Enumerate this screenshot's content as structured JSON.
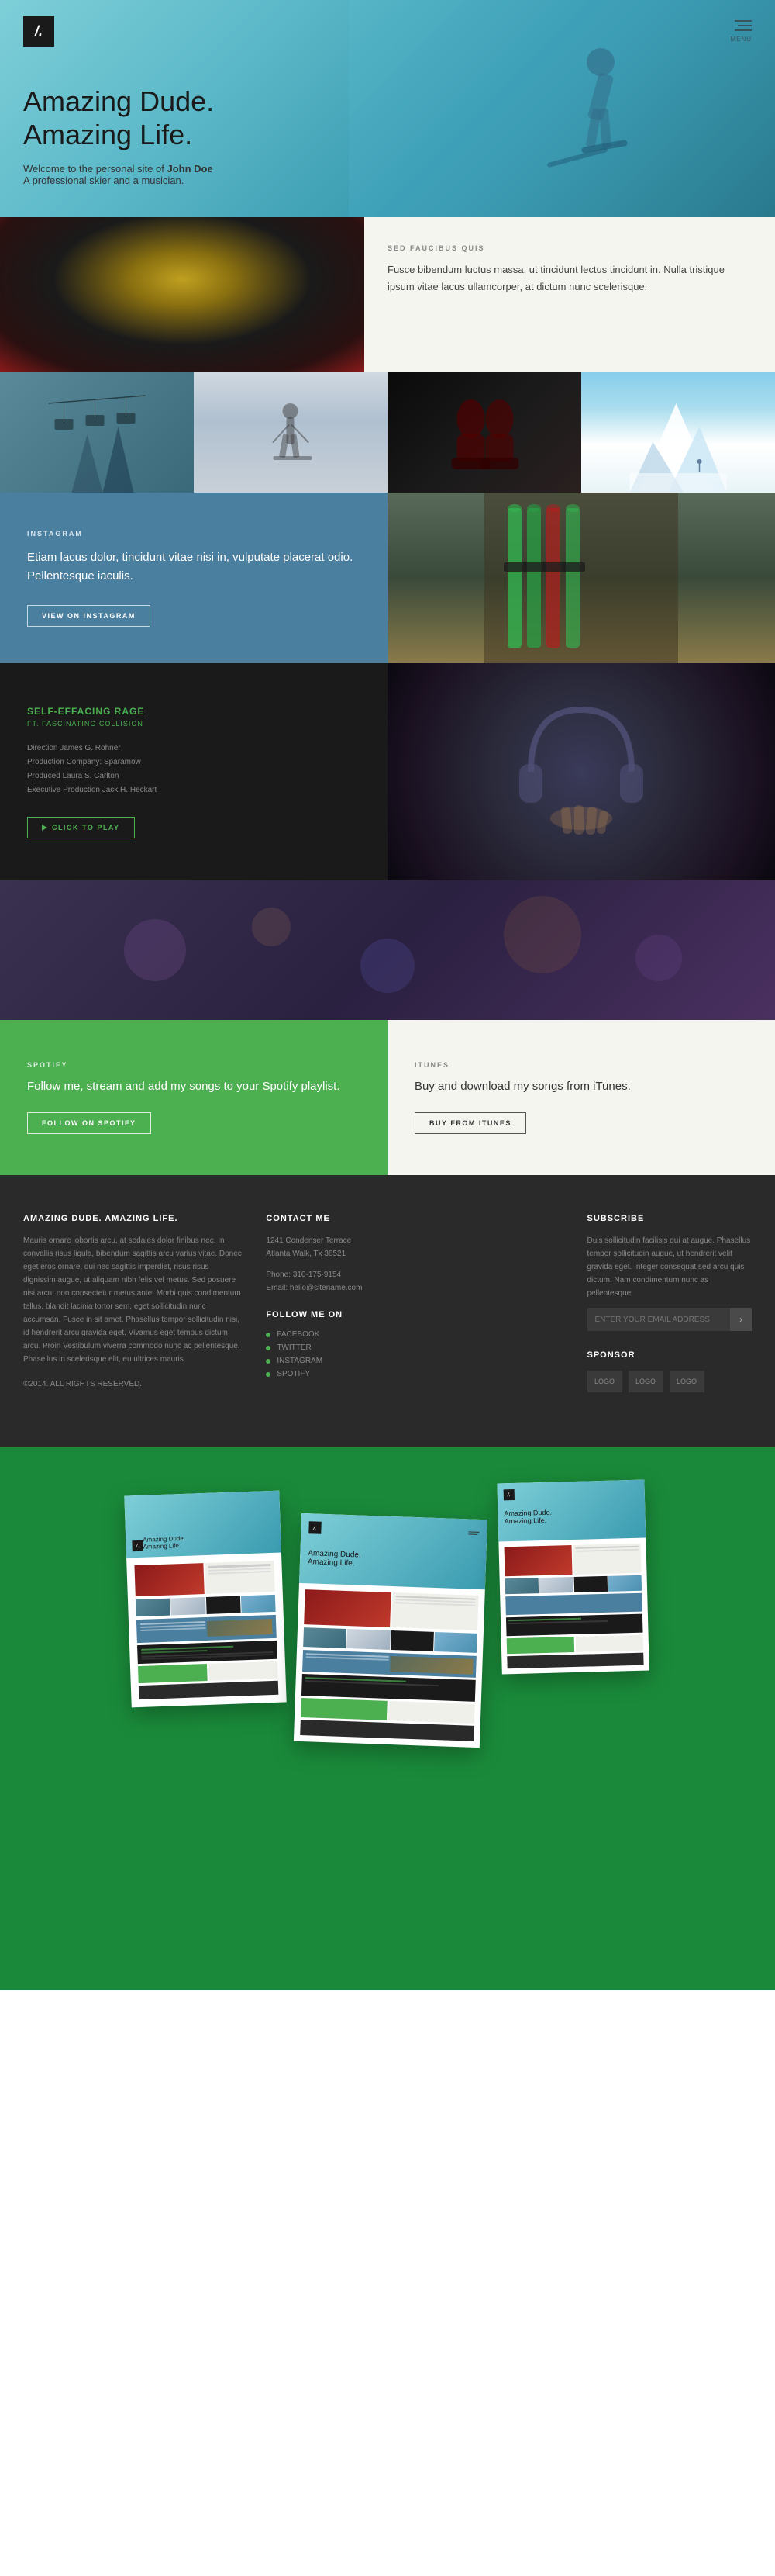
{
  "header": {
    "logo": "/.",
    "menu_label": "MENU",
    "title_line1": "Amazing Dude.",
    "title_line2": "Amazing Life.",
    "subtitle": "Welcome to the personal site of",
    "name": "John Doe",
    "description": "A professional skier and a musician."
  },
  "section_faucibus": {
    "label": "SED FAUCIBUS QUIS",
    "text": "Fusce bibendum luctus massa, ut tincidunt lectus tincidunt in. Nulla tristique ipsum vitae lacus ullamcorper, at dictum nunc scelerisque."
  },
  "instagram": {
    "label": "INSTAGRAM",
    "text": "Etiam lacus dolor, tincidunt vitae nisi in, vulputate placerat odio. Pellentesque iaculis.",
    "button": "VIEW ON INSTAGRAM"
  },
  "music_video": {
    "title": "SELF-EFFACING RAGE",
    "subtitle": "FT. FASCINATING COLLISION",
    "credit1": "Direction James G. Rohner",
    "credit2": "Production Company: Sparamow",
    "credit3": "Produced Laura S. Carlton",
    "credit4": "Executive Production Jack H. Heckart",
    "button": "CLICK TO PLAY"
  },
  "spotify": {
    "label": "SPOTIFY",
    "text": "Follow me, stream and add my songs to your Spotify playlist.",
    "button": "FOLLOW ON SPOTIFY"
  },
  "itunes": {
    "label": "ITUNES",
    "text": "Buy and download my songs from iTunes.",
    "button": "BUY FROM ITUNES"
  },
  "footer": {
    "brand_title": "AMAZING DUDE. AMAZING LIFE.",
    "brand_text": "Mauris ornare lobortis arcu, at sodales dolor finibus nec. In convallis risus ligula, bibendum sagittis arcu varius vitae. Donec eget eros ornare, dui nec sagittis imperdiet, risus risus dignissim augue, ut aliquam nibh felis vel metus. Sed posuere nisi arcu, non consectetur metus ante. Morbi quis condimentum tellus, blandit lacinia tortor sem, eget sollicitudin nunc accumsan. Fusce in sit amet. Phasellus tempor sollicitudin nisi, id hendrerit arcu gravida eget. Vivamus eget tempus dictum arcu. Proin Vestibulum viverra commodo nunc ac pellentesque. Phasellus in scelerisque elit, eu ultrices mauris.",
    "copyright": "©2014. ALL RIGHTS RESERVED.",
    "contact_title": "CONTACT ME",
    "address_line1": "1241 Condenser Terrace",
    "address_line2": "Atlanta Walk, Tx 38521",
    "phone_label": "Phone:",
    "phone": "310-175-9154",
    "email_label": "Email:",
    "email": "hello@sitename.com",
    "follow_title": "FOLLOW ME ON",
    "social_links": [
      {
        "label": "FACEBOOK"
      },
      {
        "label": "TWITTER"
      },
      {
        "label": "INSTAGRAM"
      },
      {
        "label": "SPOTIFY"
      }
    ],
    "subscribe_title": "SUBSCRIBE",
    "subscribe_text": "Duis sollicitudin facilisis dui at augue. Phasellus tempor sollicitudin augue, ut hendrerit velit gravida eget. Integer consequat sed arcu quis dictum. Nam condimentum nunc as pellentesque.",
    "input_placeholder": "ENTER YOUR EMAIL ADDRESS",
    "sponsor_title": "SPONSOR",
    "sponsor_logos": [
      "LOGO",
      "LOGO",
      "LOGO"
    ]
  },
  "photo_grid": {
    "cells": [
      {
        "alt": "chair-lift"
      },
      {
        "alt": "skier-field"
      },
      {
        "alt": "ski-boots"
      },
      {
        "alt": "mountains"
      }
    ]
  }
}
